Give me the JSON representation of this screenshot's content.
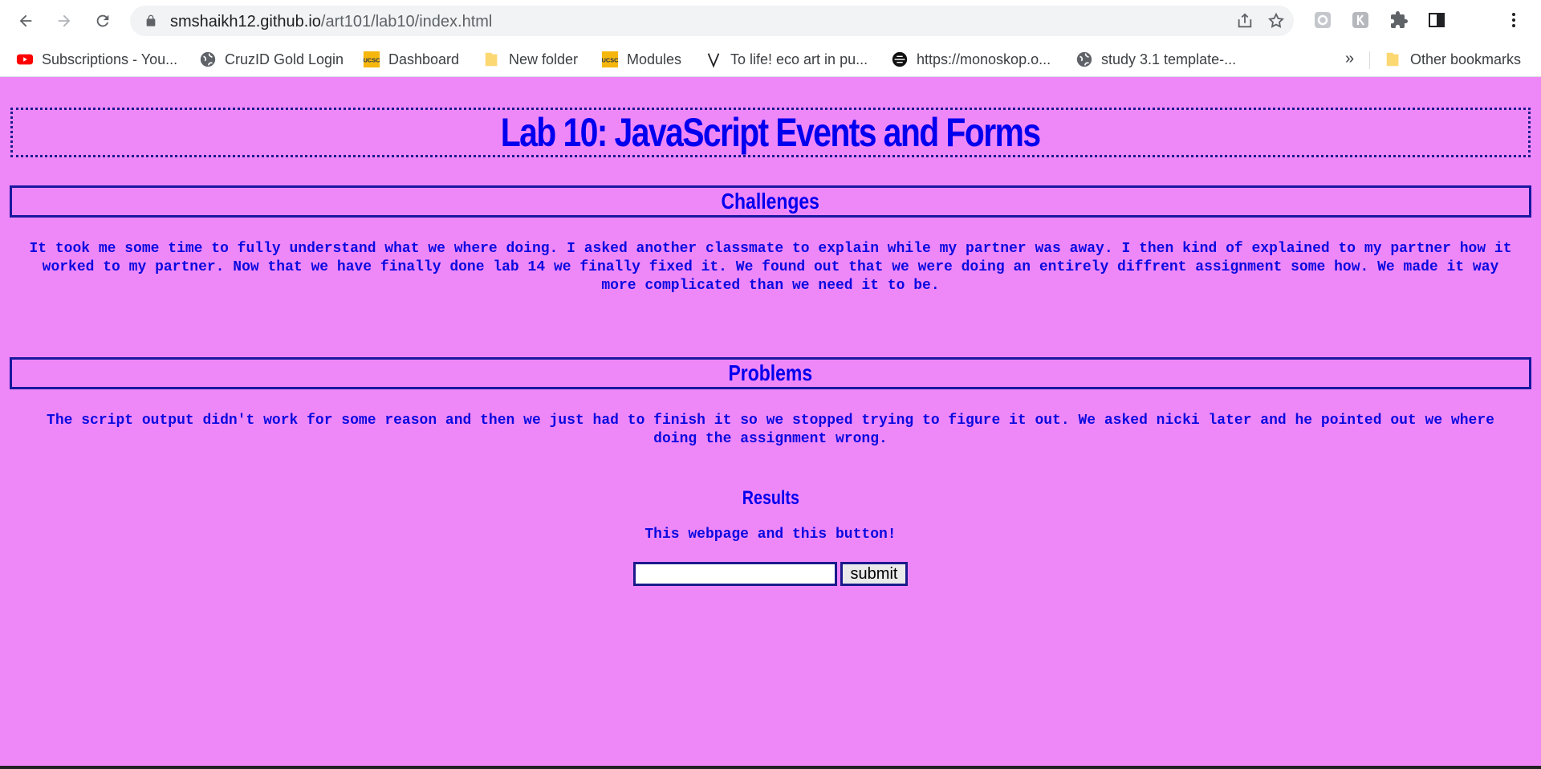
{
  "browser": {
    "url_host": "smshaikh12.github.io",
    "url_path": "/art101/lab10/index.html"
  },
  "bookmarks": [
    {
      "label": "Subscriptions - You...",
      "icon": "youtube-icon"
    },
    {
      "label": "CruzID Gold Login",
      "icon": "globe-icon"
    },
    {
      "label": "Dashboard",
      "icon": "ucsc-icon"
    },
    {
      "label": "New folder",
      "icon": "folder-icon"
    },
    {
      "label": "Modules",
      "icon": "ucsc-icon"
    },
    {
      "label": "To life! eco art in pu...",
      "icon": "v-icon"
    },
    {
      "label": "https://monoskop.o...",
      "icon": "monoskop-icon"
    },
    {
      "label": "study 3.1 template-...",
      "icon": "globe-icon"
    }
  ],
  "bookmarks_more": "»",
  "other_bookmarks": "Other bookmarks",
  "page": {
    "title": "Lab 10: JavaScript Events and Forms",
    "challenges_heading": "Challenges",
    "challenges_text": "It took me some time to fully understand what we where doing. I asked another classmate to explain while my partner was away. I then kind of explained to my partner how it worked to my partner. Now that we have finally done lab 14 we finally fixed it. We found out that we were doing an entirely diffrent assignment some how. We made it way more complicated than we need it to be.",
    "problems_heading": "Problems",
    "problems_text": "The script output didn't work for some reason and then we just had to finish it so we stopped trying to figure it out. We asked nicki later and he pointed out we where doing the assignment wrong.",
    "results_heading": "Results",
    "results_text": "This webpage and this button!",
    "input_value": "",
    "submit_label": "submit"
  },
  "colors": {
    "page_background": "#ee88f8",
    "text": "#0000ee",
    "border": "#1818a0"
  }
}
